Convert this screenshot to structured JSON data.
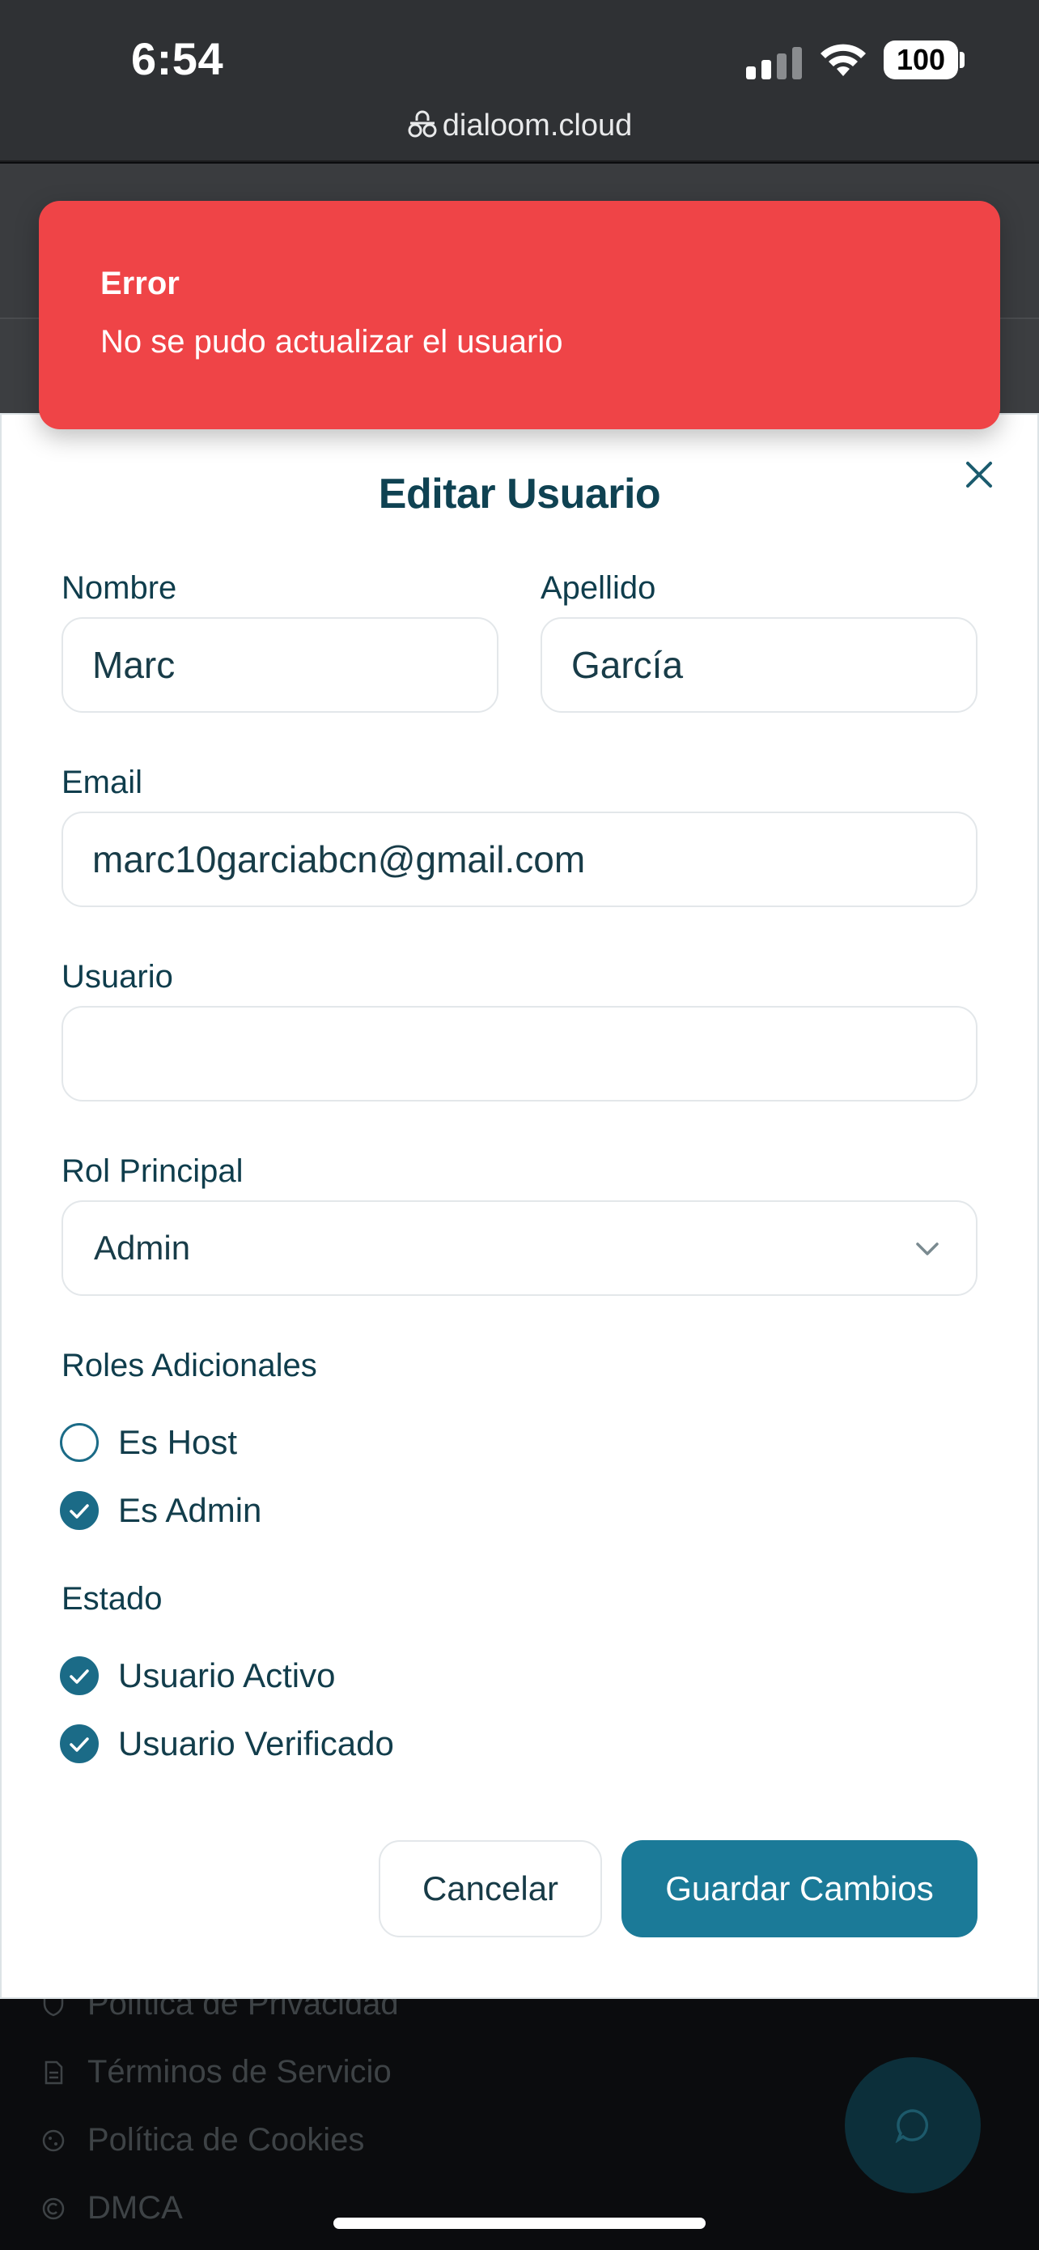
{
  "status_bar": {
    "time": "6:54",
    "battery": "100",
    "url": "dialoom.cloud"
  },
  "toast": {
    "title": "Error",
    "message": "No se pudo actualizar el usuario",
    "color": "#ef4447"
  },
  "modal": {
    "title": "Editar Usuario",
    "fields": {
      "first_name": {
        "label": "Nombre",
        "value": "Marc"
      },
      "last_name": {
        "label": "Apellido",
        "value": "García"
      },
      "email": {
        "label": "Email",
        "value": "marc10garciabcn@gmail.com"
      },
      "username": {
        "label": "Usuario",
        "value": ""
      },
      "primary_role": {
        "label": "Rol Principal",
        "value": "Admin"
      }
    },
    "additional_roles": {
      "label": "Roles Adicionales",
      "items": [
        {
          "label": "Es Host",
          "checked": false
        },
        {
          "label": "Es Admin",
          "checked": true
        }
      ]
    },
    "status": {
      "label": "Estado",
      "items": [
        {
          "label": "Usuario Activo",
          "checked": true
        },
        {
          "label": "Usuario Verificado",
          "checked": true
        }
      ]
    },
    "buttons": {
      "cancel": "Cancelar",
      "save": "Guardar Cambios"
    },
    "accent_color": "#1b7a98"
  },
  "footer": {
    "links": [
      "Política de Privacidad",
      "Términos de Servicio",
      "Política de Cookies",
      "DMCA"
    ]
  },
  "icons": [
    "lock-icon",
    "close-icon",
    "chevron-down-icon",
    "check-icon",
    "chat-icon",
    "shield-icon",
    "document-icon",
    "cookie-icon",
    "copyright-icon"
  ]
}
